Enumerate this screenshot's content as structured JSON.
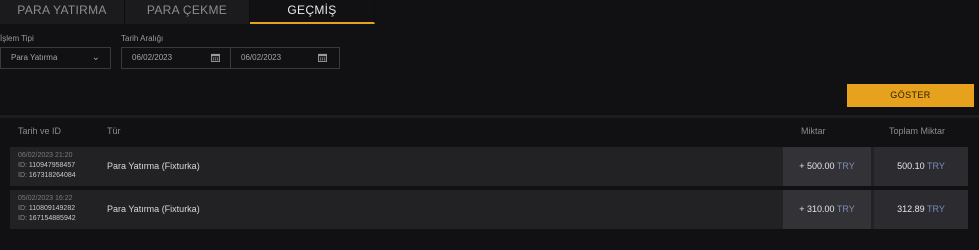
{
  "tabs": [
    {
      "label": "PARA YATIRMA"
    },
    {
      "label": "PARA ÇEKME"
    },
    {
      "label": "GEÇMİŞ",
      "active": true
    }
  ],
  "filters": {
    "type_label": "İşlem Tipi",
    "type_value": "Para Yatırma",
    "range_label": "Tarih Aralığı",
    "date_from": "06/02/2023",
    "date_to": "06/02/2023"
  },
  "show_button": "GÖSTER",
  "table": {
    "headers": {
      "date_id": "Tarih ve ID",
      "type": "Tür",
      "amount": "Miktar",
      "total": "Toplam Miktar"
    },
    "rows": [
      {
        "datetime": "06/02/2023 21:20",
        "id_label": "ID:",
        "id1": "110947958457",
        "id2": "167318264084",
        "type": "Para Yatırma (Fixturka)",
        "amount": "+ 500.00",
        "total": "500.10",
        "currency": "TRY"
      },
      {
        "datetime": "05/02/2023 16:22",
        "id_label": "ID:",
        "id1": "110809149282",
        "id2": "167154885942",
        "type": "Para Yatırma (Fixturka)",
        "amount": "+ 310.00",
        "total": "312.89",
        "currency": "TRY"
      }
    ]
  },
  "colors": {
    "accent": "#e6a21c",
    "background": "#111012",
    "row": "#222124"
  },
  "icons": {
    "select_chevron": "chevron-down-icon",
    "calendar": "calendar-icon"
  }
}
